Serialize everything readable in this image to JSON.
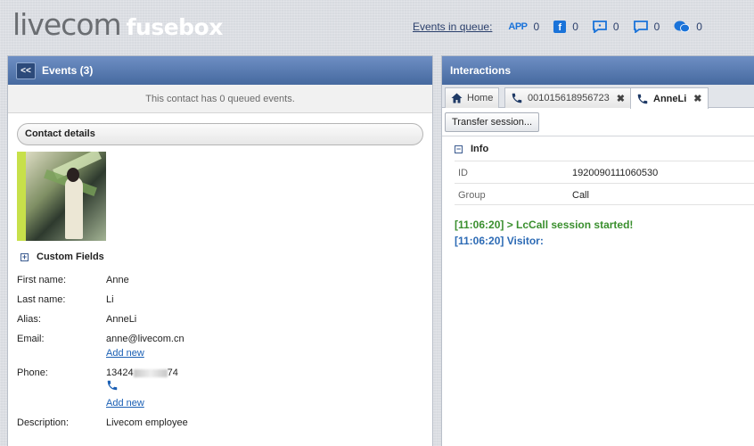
{
  "header": {
    "logo_primary": "livecom",
    "logo_secondary": "fusebox",
    "queue_label": "Events in queue:",
    "queue_items": [
      {
        "icon": "app-icon",
        "label": "APP",
        "count": "0"
      },
      {
        "icon": "facebook-icon",
        "label": "f",
        "count": "0"
      },
      {
        "icon": "sms-icon",
        "count": "0"
      },
      {
        "icon": "chat-icon",
        "count": "0"
      },
      {
        "icon": "wechat-icon",
        "count": "0"
      }
    ]
  },
  "left_panel": {
    "back_label": "<<",
    "title": "Events (3)",
    "queued_message": "This contact has 0 queued events.",
    "contact_details_label": "Contact details",
    "custom_fields_label": "Custom Fields",
    "fields": {
      "first_name_label": "First name:",
      "first_name": "Anne",
      "last_name_label": "Last name:",
      "last_name": "Li",
      "alias_label": "Alias:",
      "alias": "AnneLi",
      "email_label": "Email:",
      "email": "anne@livecom.cn",
      "email_add_new": "Add new",
      "phone_label": "Phone:",
      "phone_prefix": "13424",
      "phone_suffix": "74",
      "phone_add_new": "Add new",
      "description_label": "Description:",
      "description": "Livecom employee"
    }
  },
  "right_panel": {
    "title": "Interactions",
    "tabs": [
      {
        "label": "Home",
        "icon": "home-icon"
      },
      {
        "label": "001015618956723",
        "icon": "phone-icon",
        "closable": true
      },
      {
        "label": "AnneLi",
        "icon": "phone-icon",
        "closable": true,
        "active": true
      }
    ],
    "transfer_label": "Transfer session...",
    "info_label": "Info",
    "info_rows": [
      {
        "key": "ID",
        "value": "1920090111060530"
      },
      {
        "key": "Group",
        "value": "Call"
      }
    ],
    "log": [
      {
        "text": "[11:06:20] > LcCall session started!",
        "color": "#3a8f2e"
      },
      {
        "text": "[11:06:20] Visitor:",
        "color": "#2d6bb5"
      }
    ]
  },
  "colors": {
    "panel_header": "#46699f",
    "accent_blue": "#1a73d9",
    "link": "#1a5fb4",
    "log_green": "#3a8f2e",
    "log_blue": "#2d6bb5"
  }
}
